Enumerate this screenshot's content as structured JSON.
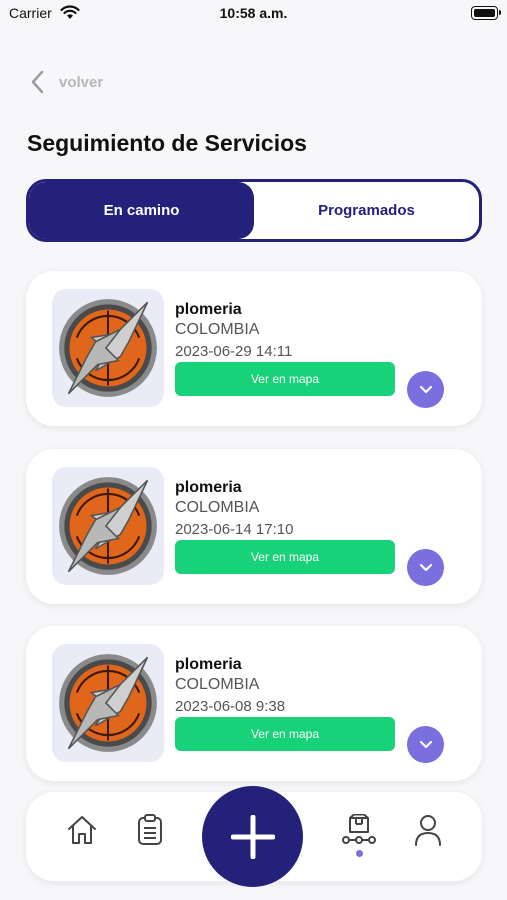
{
  "status_bar": {
    "carrier": "Carrier",
    "time": "10:58 a.m."
  },
  "header": {
    "back_label": "volver",
    "title": "Seguimiento de Servicios"
  },
  "tabs": [
    {
      "label": "En camino",
      "active": true
    },
    {
      "label": "Programados",
      "active": false
    }
  ],
  "services": [
    {
      "name": "plomeria",
      "country": "COLOMBIA",
      "datetime": "2023-06-29 14:11",
      "map_label": "Ver en mapa"
    },
    {
      "name": "plomeria",
      "country": "COLOMBIA",
      "datetime": "2023-06-14 17:10",
      "map_label": "Ver en mapa"
    },
    {
      "name": "plomeria",
      "country": "COLOMBIA",
      "datetime": "2023-06-08 9:38",
      "map_label": "Ver en mapa"
    }
  ],
  "bottom_nav": {
    "items": [
      "home-icon",
      "clipboard-icon",
      "plus-icon",
      "delivery-tracking-icon",
      "user-icon"
    ],
    "active": "delivery-tracking-icon"
  },
  "colors": {
    "primary": "#23217a",
    "map_button": "#18d27a",
    "accent": "#7b6fe0"
  }
}
